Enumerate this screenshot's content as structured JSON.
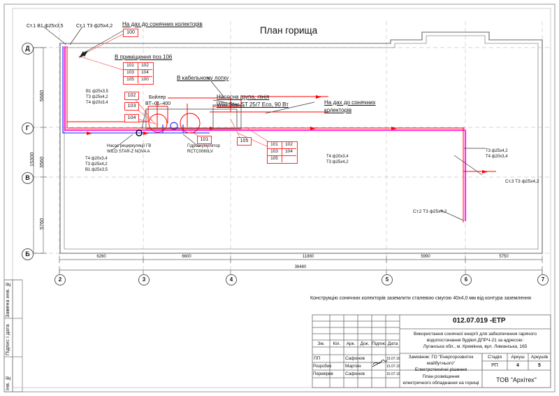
{
  "drawing": {
    "title": "План горища",
    "sheet_note": "Конструкцію сонячних колекторів заземлити сталевою смугою 40х4,0 мм від контура заземлення"
  },
  "margin_labels": {
    "left": [
      "Замена инв. №",
      "Підпис і дата",
      "Інв. №"
    ]
  },
  "annotations": {
    "riser_b1": "Ст.1 В1 ф25х3,5",
    "riser_t3": "Ст.1 Т3 ф25х4,2",
    "roof_top": "На дах до сонячних колекторів",
    "room_106": "В приміщення поз.106",
    "cable_tray": "В кабельному лотку",
    "boiler_name": "Бойлер",
    "boiler_model": "BT–01–400",
    "pump_group_line1": "Насосна група, лінія",
    "pump_group_line2": "Wilo Star ST 25/7 Eco, 90 Вт",
    "roof_right_line1": "На дах до сонячних",
    "roof_right_line2": "колекторів",
    "circ_pump_line1": "Насос рециркуляції ГВ",
    "circ_pump_line2": "WILO STAR-Z NOVA A",
    "accumulator_line1": "Гідроакумулятор",
    "accumulator_line2": "RCTC0060LV",
    "pipes_left": [
      "В1 ф25х3,5",
      "Т3 ф25х4,2",
      "Т4 ф20х3,4"
    ],
    "pipes_left_lower": [
      "Т4 ф20х3,4",
      "Т3 ф25х4,2",
      "В1 ф25х3,5"
    ],
    "pipes_mid": [
      "Т4 ф20х3,4",
      "Т3 ф25х4,2"
    ],
    "pipes_right": [
      "Т3 ф25х4,2",
      "Т4 ф20х3,4"
    ],
    "riser3": "Ст.3 Т3 ф25х4,2",
    "riser2": "Ст.2 Т3 ф25х4,2"
  },
  "tags": {
    "roof_tag": "100",
    "grid_room106": [
      [
        "101",
        "102"
      ],
      [
        "103",
        "104"
      ],
      [
        "105",
        "100"
      ]
    ],
    "grid_right": [
      [
        "101",
        "102"
      ],
      [
        "103",
        "104"
      ],
      [
        "105",
        ""
      ]
    ],
    "left_stack": [
      "102",
      "103",
      "104"
    ],
    "mid_101": "101",
    "mid_105": "105"
  },
  "grid": {
    "vertical_axes": [
      "2",
      "3",
      "4",
      "5",
      "6",
      "7"
    ],
    "horizontal_axes": [
      "Д",
      "Г",
      "В",
      "Б"
    ],
    "h_dims": [
      "6260",
      "6600",
      "11880",
      "5990",
      "5750"
    ],
    "h_total": "36480",
    "v_dims": [
      "5680",
      "3560",
      "5760"
    ],
    "v_total": "15300"
  },
  "title_block": {
    "code": "012.07.019 -ЕТР",
    "description": [
      "Використання сонячної енергії для забезпечення гарячого",
      "водопостачання будівлі ДПРЧ-21 за адресою:",
      "Луганська обл., м. Кремінна, вул. Лиманська, 165"
    ],
    "revision_headers": [
      "Зм.",
      "Кіл.",
      "Арк.",
      "Док.",
      "Підпис",
      "Дата"
    ],
    "rows": [
      {
        "role": "ПП",
        "name": "Сафонов",
        "sign": "",
        "date": "15.07.19"
      },
      {
        "role": "Розробив",
        "name": "Мартин",
        "sign": "М. Мартин",
        "date": "15.07.19"
      },
      {
        "role": "Перевірив",
        "name": "Сафонов",
        "sign": "",
        "date": "15.07.19"
      }
    ],
    "client_lines": [
      "Замовник: ГО \"Енергорозвиток",
      "майбутнього\"",
      "Електротехнічні рішення"
    ],
    "stage_headers": [
      "Стадія",
      "Аркуш",
      "Аркушів"
    ],
    "stage_values": [
      "РП",
      "4",
      "5"
    ],
    "sheet_name": [
      "План розміщення",
      "електричного обладнання на горищі"
    ],
    "company": "ТОВ \"Архітех\""
  },
  "colors": {
    "red": "#ff0000",
    "magenta": "#ff2de0",
    "blue": "#0000ff",
    "tag_border": "#ff2b2b",
    "wall": "#555555",
    "grid_dash": "#bbbbbb"
  }
}
